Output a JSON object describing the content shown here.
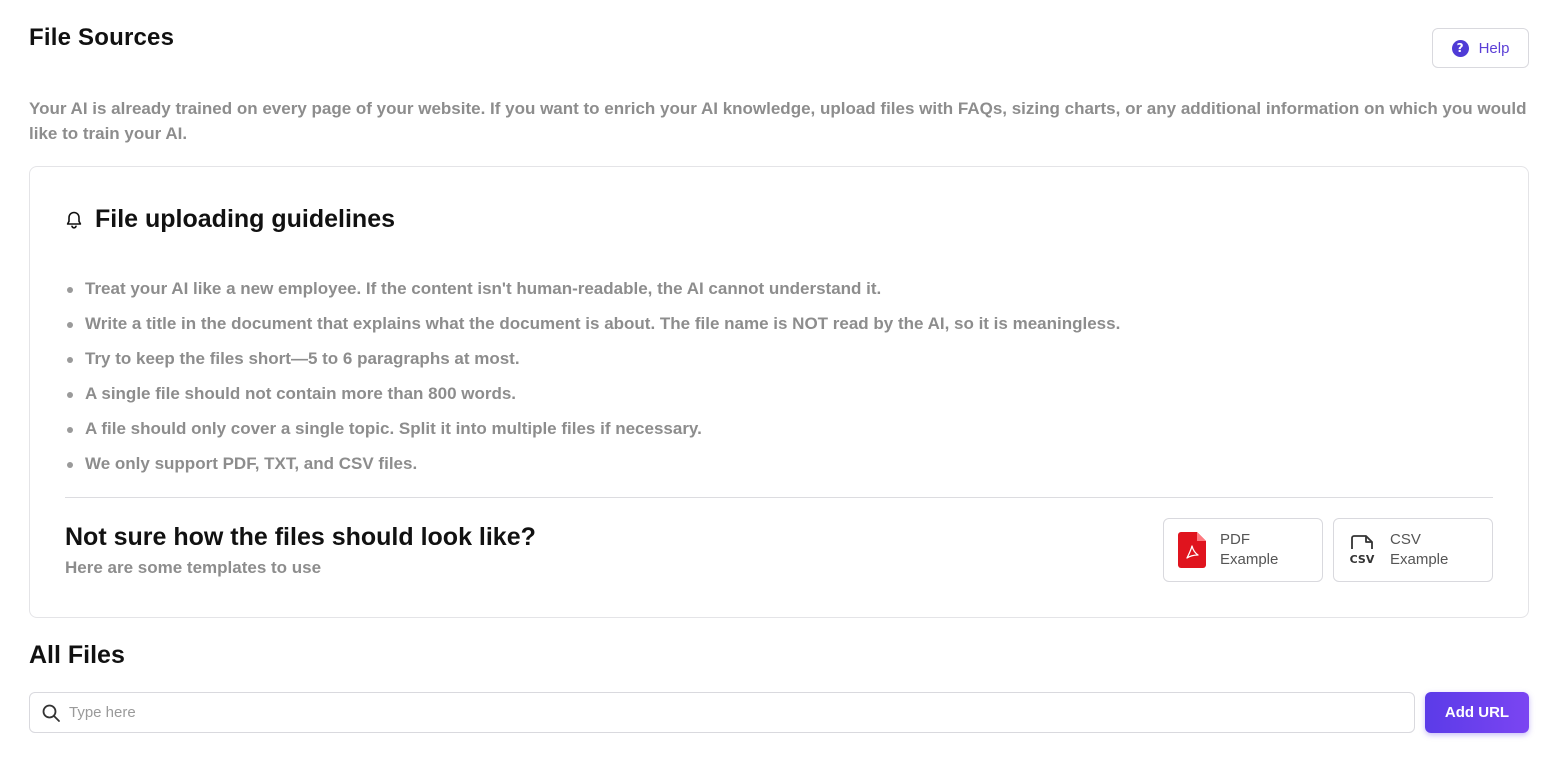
{
  "header": {
    "title": "File Sources",
    "help_label": "Help",
    "help_icon": "question-circle-icon"
  },
  "intro": "Your AI is already trained on every page of your website. If you want to enrich your AI knowledge, upload files with FAQs, sizing charts, or any additional information on which you would like to train your AI.",
  "guidelines": {
    "icon": "bell-icon",
    "title": "File uploading guidelines",
    "items": [
      "Treat your AI like a new employee. If the content isn't human-readable, the AI cannot understand it.",
      "Write a title in the document that explains what the document is about. The file name is NOT read by the AI, so it is meaningless.",
      "Try to keep the files short—5 to 6 paragraphs at most.",
      "A single file should not contain more than 800 words.",
      "A file should only cover a single topic. Split it into multiple files if necessary.",
      "We only support PDF, TXT, and CSV files."
    ]
  },
  "templates": {
    "title": "Not sure how the files should look like?",
    "subtitle": "Here are some templates to use",
    "pdf": {
      "line1": "PDF",
      "line2": "Example",
      "icon": "pdf-file-icon",
      "color": "#e0141e"
    },
    "csv": {
      "line1": "CSV",
      "line2": "Example",
      "icon": "csv-file-icon",
      "icon_text": "CSV"
    }
  },
  "files": {
    "title": "All Files",
    "search_placeholder": "Type here",
    "search_value": "",
    "add_url_label": "Add URL",
    "accent": "#5b3be8"
  }
}
